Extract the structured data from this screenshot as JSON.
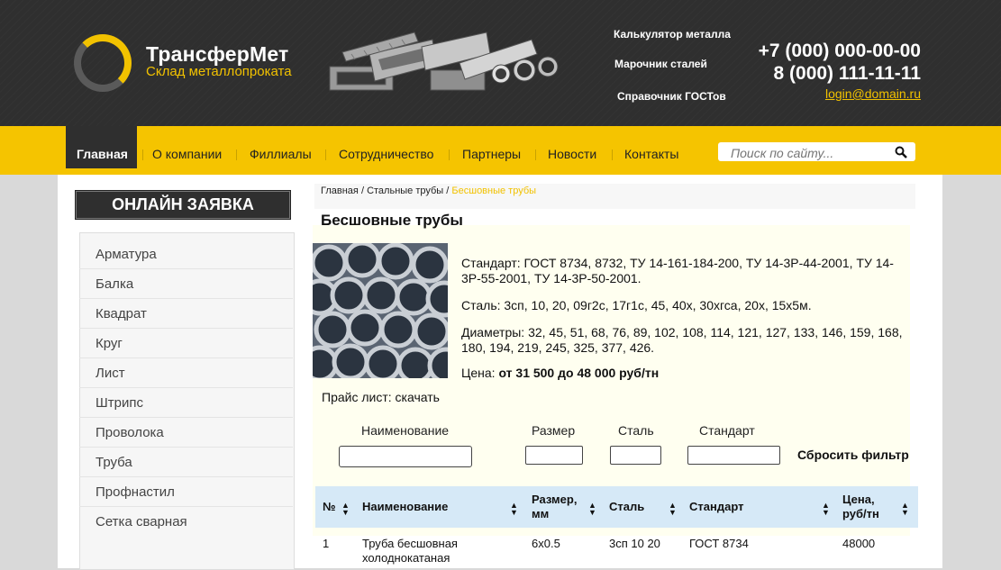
{
  "header": {
    "logo_title": "ТрансферМет",
    "logo_subtitle": "Склад металлопроката",
    "links": [
      "Калькулятор металла",
      "Марочник сталей",
      "Справочник ГОСТов"
    ],
    "phone1": "+7 (000) 000-00-00",
    "phone2": "8 (000) 111-11-11",
    "email": "login@domain.ru",
    "accent_color": "#f2c200"
  },
  "nav": {
    "items": [
      "Главная",
      "О компании",
      "Филлиалы",
      "Сотрудничество",
      "Партнеры",
      "Новости",
      "Контакты"
    ],
    "active": "Главная"
  },
  "search": {
    "placeholder": "Поиск по сайту..."
  },
  "sidebar": {
    "order_button": "ОНЛАЙН ЗАЯВКА",
    "items": [
      "Арматура",
      "Балка",
      "Квадрат",
      "Круг",
      "Лист",
      "Штрипс",
      "Проволока",
      "Труба",
      "Профнастил",
      "Сетка сварная"
    ]
  },
  "breadcrumb": {
    "home": "Главная",
    "section": "Стальные трубы",
    "current": "Бесшовные трубы"
  },
  "product": {
    "title": "Бесшовные трубы",
    "standard": "Стандарт: ГОСТ 8734, 8732, ТУ 14-161-184-200, ТУ 14-3Р-44-2001, ТУ 14-3Р-55-2001, ТУ 14-3Р-50-2001.",
    "steel": "Сталь: 3сп, 10, 20, 09г2с, 17г1с, 45, 40х, 30хгса, 20х, 15х5м.",
    "diameters": "Диаметры: 32, 45, 51, 68, 76, 89, 102, 108, 114, 121, 127, 133, 146, 159, 168, 180, 194, 219, 245, 325, 377, 426.",
    "price_label": "Цена:",
    "price_value": "от 31 500 до 48 000 руб/тн",
    "pricelist_label": "Прайс лист:",
    "pricelist_link": "скачать"
  },
  "filter": {
    "name_label": "Наименование",
    "size_label": "Размер",
    "steel_label": "Сталь",
    "standard_label": "Стандарт",
    "reset": "Сбросить фильтр"
  },
  "table": {
    "headers": [
      "№",
      "Наименование",
      "Размер, мм",
      "Сталь",
      "Стандарт",
      "Цена, руб/тн"
    ],
    "rows": [
      [
        "1",
        "Труба бесшовная холоднокатаная",
        "6х0.5",
        "3сп 10 20",
        "ГОСТ 8734",
        "48000"
      ]
    ]
  }
}
